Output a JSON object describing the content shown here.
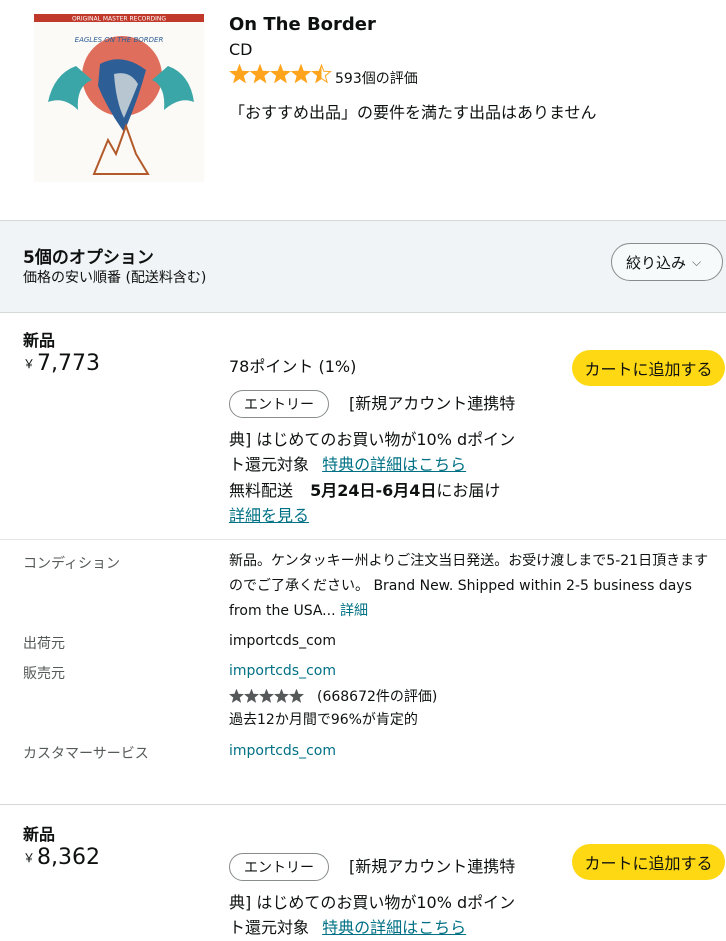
{
  "product": {
    "title": "On The Border",
    "format": "CD",
    "rating": 4.5,
    "rating_count": "593個の評価",
    "note": "「おすすめ出品」の要件を満たす出品はありません",
    "album_art": {
      "top_text": "ORIGINAL MASTER RECORDING",
      "bottom_text": "EAGLES ON THE BORDER"
    }
  },
  "options": {
    "title": "5個のオプション",
    "subtitle": "価格の安い順番 (配送料含む)",
    "filter_label": "絞り込み"
  },
  "offers": [
    {
      "condition": "新品",
      "currency": "￥",
      "price": "7,773",
      "points": "78ポイント (1%)",
      "cart_label": "カートに追加する",
      "entry_label": "エントリー",
      "promo_line1": "[新規アカウント連携特",
      "promo_line2": "典] はじめてのお買い物が10% dポイン",
      "promo_line3": "ト還元対象",
      "promo_link": "特典の詳細はこちら",
      "delivery_prefix": "無料配送",
      "delivery_dates": "5月24日-6月4日",
      "delivery_suffix": "にお届け",
      "details_link": "詳細を見る",
      "condition_label": "コンディション",
      "condition_text": "新品。ケンタッキー州よりご注文当日発送。お受け渡しまで5-21日頂きますのでご了承ください。 Brand New. Shipped within 2-5 business days from the USA...",
      "condition_more": "詳細",
      "shipper_label": "出荷元",
      "shipper": "importcds_com",
      "seller_label": "販売元",
      "seller": "importcds_com",
      "seller_stars": 5,
      "seller_rating": "(668672件の評価)",
      "seller_positive": "過去12か月間で96%が肯定的",
      "service_label": "カスタマーサービス",
      "service": "importcds_com"
    },
    {
      "condition": "新品",
      "currency": "￥",
      "price": "8,362",
      "cart_label": "カートに追加する",
      "entry_label": "エントリー",
      "promo_line1": "[新規アカウント連携特",
      "promo_line2": "典] はじめてのお買い物が10% dポイン",
      "promo_line3": "ト還元対象",
      "promo_link": "特典の詳細はこちら"
    }
  ],
  "colors": {
    "star": "#ffa41c",
    "cart": "#ffd814",
    "link": "#007185",
    "band": "#f1f4f6"
  }
}
